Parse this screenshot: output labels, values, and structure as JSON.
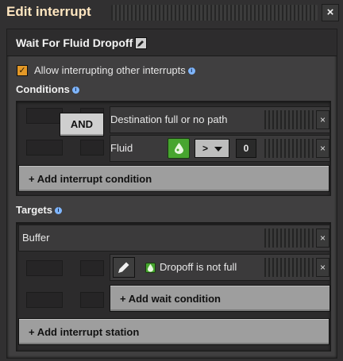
{
  "window": {
    "title": "Edit interrupt",
    "close_glyph": "×"
  },
  "interrupt": {
    "name": "Wait For Fluid Dropoff",
    "rename_icon": "pencil-icon"
  },
  "allow_interrupting": {
    "label": "Allow interrupting other interrupts",
    "checked": true
  },
  "conditions": {
    "title": "Conditions",
    "logic_button": "AND",
    "rows": [
      {
        "label": "Destination full or no path"
      },
      {
        "label": "Fluid",
        "icon": "fluid-drop-icon",
        "comparator": ">",
        "value": "0"
      }
    ],
    "add_label": "+ Add interrupt condition"
  },
  "targets": {
    "title": "Targets",
    "station": "Buffer",
    "wait_conditions": [
      {
        "label": "Dropoff is not full",
        "icon": "fluid-drop-icon"
      }
    ],
    "add_wait_label": "+ Add wait condition",
    "add_station_label": "+ Add interrupt station"
  },
  "colors": {
    "accent": "#e39827",
    "fluid_icon": "#47a52f",
    "title": "#ffe6c0"
  }
}
